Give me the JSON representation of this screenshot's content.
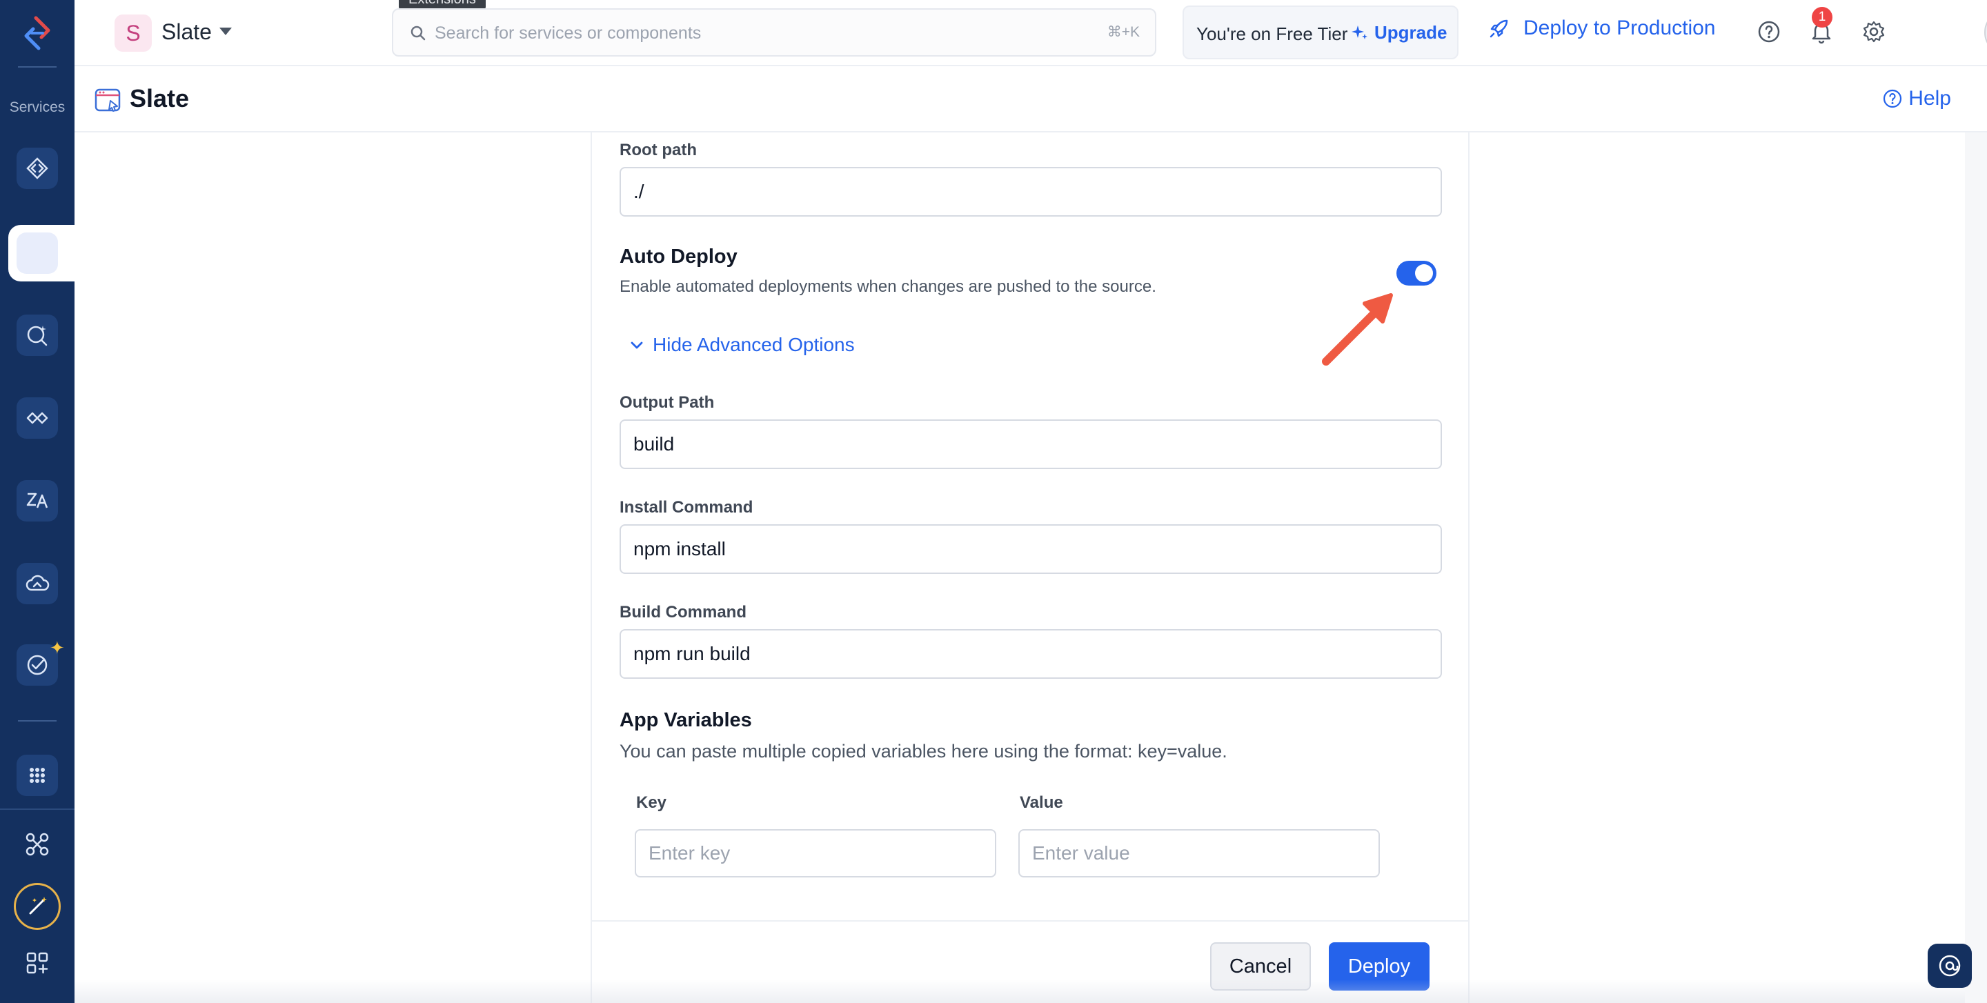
{
  "rail": {
    "section_label": "Services",
    "icons": [
      "logo-icon",
      "api-icon",
      "static-site-icon",
      "search-bot-icon",
      "integration-icon",
      "translate-icon",
      "cloud-icon",
      "check-ai-icon",
      "apps-grid-icon",
      "connections-icon",
      "magic-wand-icon",
      "add-widget-icon"
    ]
  },
  "topbar": {
    "project_initial": "S",
    "project_name": "Slate",
    "search_placeholder": "Search for services or components",
    "search_shortcut": "⌘+K",
    "tooltip": "Extensions",
    "tier_text": "You're on Free Tier",
    "upgrade_label": "Upgrade",
    "deploy_label": "Deploy to Production",
    "notification_count": "1"
  },
  "page": {
    "title": "Slate",
    "help_label": "Help"
  },
  "form": {
    "root_path": {
      "label": "Root path",
      "value": "./"
    },
    "auto_deploy": {
      "title": "Auto Deploy",
      "description": "Enable automated deployments when changes are pushed to the source.",
      "enabled": true
    },
    "advanced_toggle_label": "Hide Advanced Options",
    "output_path": {
      "label": "Output Path",
      "value": "build"
    },
    "install_command": {
      "label": "Install Command",
      "value": "npm install"
    },
    "build_command": {
      "label": "Build Command",
      "value": "npm run build"
    },
    "app_variables": {
      "title": "App Variables",
      "description": "You can paste multiple copied variables here using the format: key=value.",
      "key_label": "Key",
      "value_label": "Value",
      "key_placeholder": "Enter key",
      "value_placeholder": "Enter value"
    }
  },
  "actions": {
    "cancel_label": "Cancel",
    "deploy_label": "Deploy"
  },
  "colors": {
    "rail_bg": "#14305f",
    "accent": "#2563eb",
    "annotation_arrow": "#ef5a42"
  }
}
